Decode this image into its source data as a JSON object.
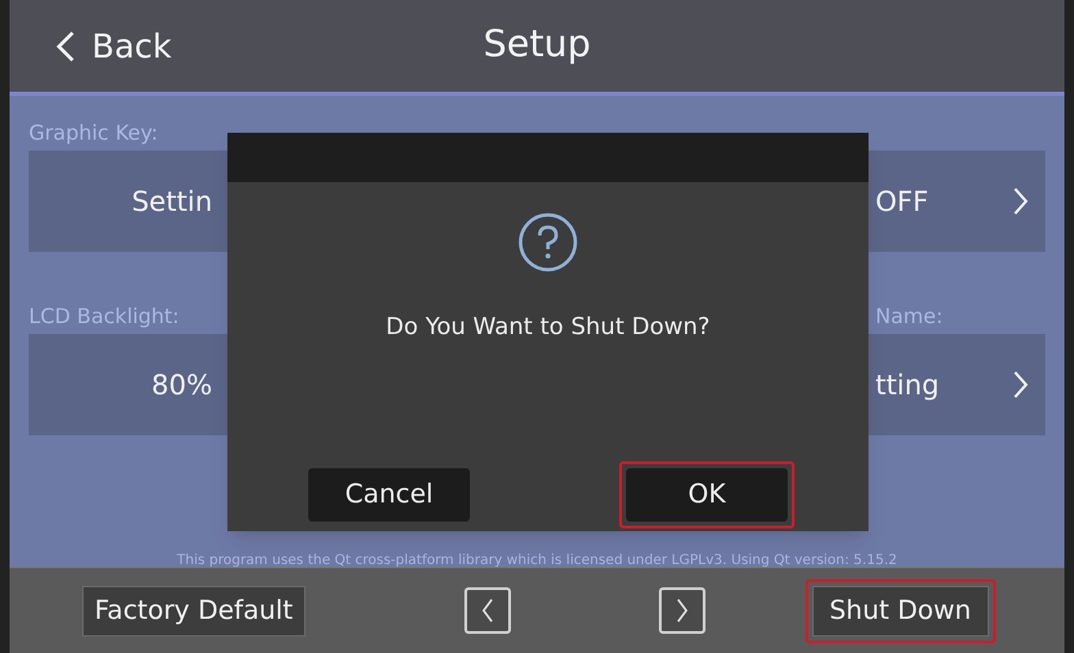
{
  "header": {
    "back": "Back",
    "title": "Setup"
  },
  "settings": [
    {
      "label": "Graphic Key:",
      "value": "Settin"
    },
    {
      "value": "OFF"
    },
    {
      "label": "LCD Backlight:",
      "value": "80%"
    },
    {
      "label": "Name:",
      "value": "tting"
    }
  ],
  "dialog": {
    "message": "Do You Want to Shut Down?",
    "buttons": [
      {
        "label": "Cancel",
        "highlighted": false
      },
      {
        "label": "OK",
        "highlighted": true
      }
    ]
  },
  "license_note": "This program uses the Qt cross-platform library which is licensed under LGPLv3. Using Qt version: 5.15.2",
  "footer": {
    "factory_default": {
      "label": "Factory Default",
      "highlighted": false
    },
    "shut_down": {
      "label": "Shut Down",
      "highlighted": true
    }
  }
}
